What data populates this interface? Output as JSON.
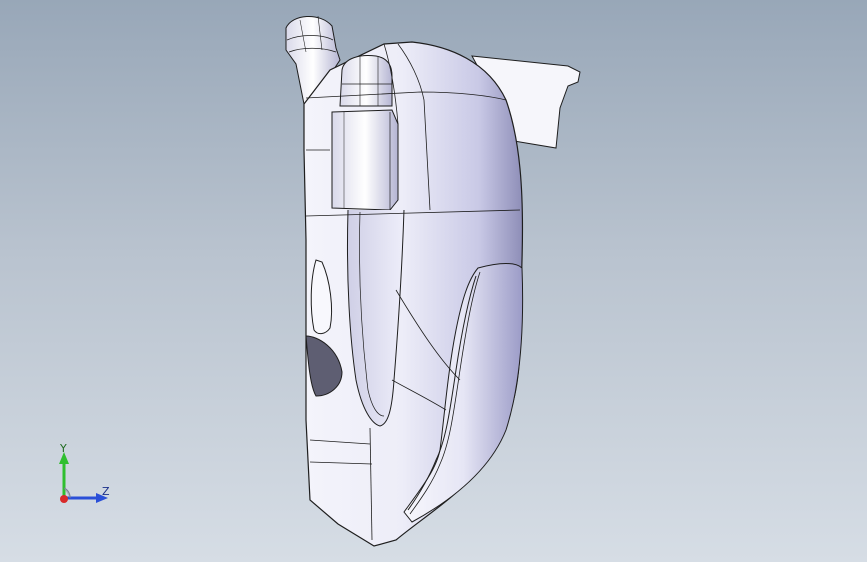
{
  "viewport": {
    "background_top": "#98a7b8",
    "background_bottom": "#d6dde5",
    "model_fill": "#e9e9f7",
    "model_shadow": "#8f8fb0",
    "edge_color": "#1e1e1e"
  },
  "triad": {
    "y_label": "Y",
    "z_label": "Z",
    "y_color": "#2fbf2f",
    "z_color": "#2a4fd8",
    "x_color": "#d82a2a"
  }
}
